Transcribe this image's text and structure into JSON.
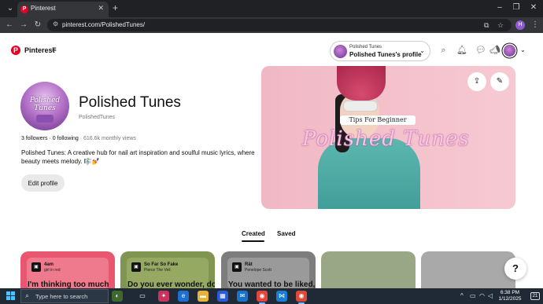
{
  "browser": {
    "tab_title": "Pinterest",
    "url": "pinterest.com/PolishedTunes/",
    "profile_initial": "H"
  },
  "header": {
    "brand": "Pinterest",
    "account_switcher": {
      "small_label": "Polished Tunes",
      "profile_label": "Polished Tunes's profile"
    }
  },
  "profile": {
    "avatar_text": "Polished Tunes",
    "name": "Polished Tunes",
    "handle": "PolishedTunes",
    "followers": "3 followers",
    "following": "0 following",
    "monthly_views": "616.6k monthly views",
    "bio": "Polished Tunes: A creative hub for nail art inspiration and soulful music lyrics, where beauty meets melody. 🎼💅",
    "edit_button": "Edit profile"
  },
  "cover": {
    "tag": "Tips For Beginner",
    "title": "Polished Tunes"
  },
  "tabs": {
    "created": "Created",
    "saved": "Saved"
  },
  "boards": [
    {
      "color": "#e9566f",
      "card_color": "#ef7a8d",
      "title": "4am",
      "artist": "girl in red",
      "big_text": "I'm thinking too much"
    },
    {
      "color": "#7f9550",
      "card_color": "#96a963",
      "title": "So Far So Fake",
      "artist": "Pierce The Veil",
      "big_text": "Do you ever wonder, do you ever wonder"
    },
    {
      "color": "#7d7d7d",
      "card_color": "#9a9a9a",
      "title": "Rät",
      "artist": "Penelope Scott",
      "big_text": "You wanted to be liked, this"
    },
    {
      "color": "#9aa787",
      "card_color": "",
      "title": "",
      "artist": "",
      "big_text": ""
    },
    {
      "color": "#a9a9a9",
      "card_color": "",
      "title": "",
      "artist": "",
      "big_text": ""
    }
  ],
  "help_label": "?",
  "taskbar": {
    "search_placeholder": "Type here to search",
    "time": "6:38 PM",
    "date": "1/12/2025",
    "notification_count": "21"
  }
}
